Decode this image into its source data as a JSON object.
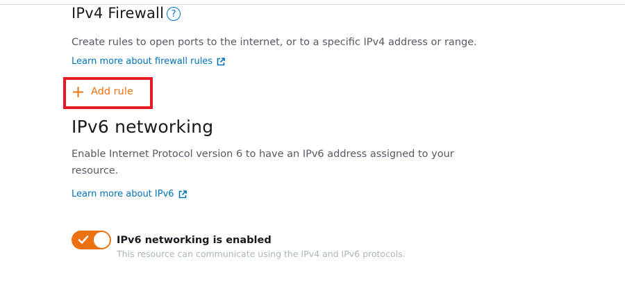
{
  "ipv4": {
    "title": "IPv4 Firewall",
    "help_glyph": "?",
    "description": "Create rules to open ports to the internet, or to a specific IPv4 address or range.",
    "learn_more_label": "Learn more about firewall rules",
    "add_rule_label": "Add rule"
  },
  "ipv6": {
    "title": "IPv6 networking",
    "description": "Enable Internet Protocol version 6 to have an IPv6 address assigned to your resource.",
    "learn_more_label": "Learn more about IPv6",
    "toggle": {
      "enabled": true,
      "label": "IPv6 networking is enabled",
      "sublabel": "This resource can communicate using the IPv4 and IPv6 protocols."
    }
  },
  "icons": {
    "help": "help-circle-icon",
    "external": "external-link-icon",
    "add": "plus-icon",
    "check": "check-icon"
  },
  "colors": {
    "accent_orange": "#ec7211",
    "link_blue": "#0073bb",
    "highlight_red": "#e41b23",
    "text_primary": "#16191f",
    "text_secondary": "#545b64",
    "text_muted": "#aab7b8"
  }
}
